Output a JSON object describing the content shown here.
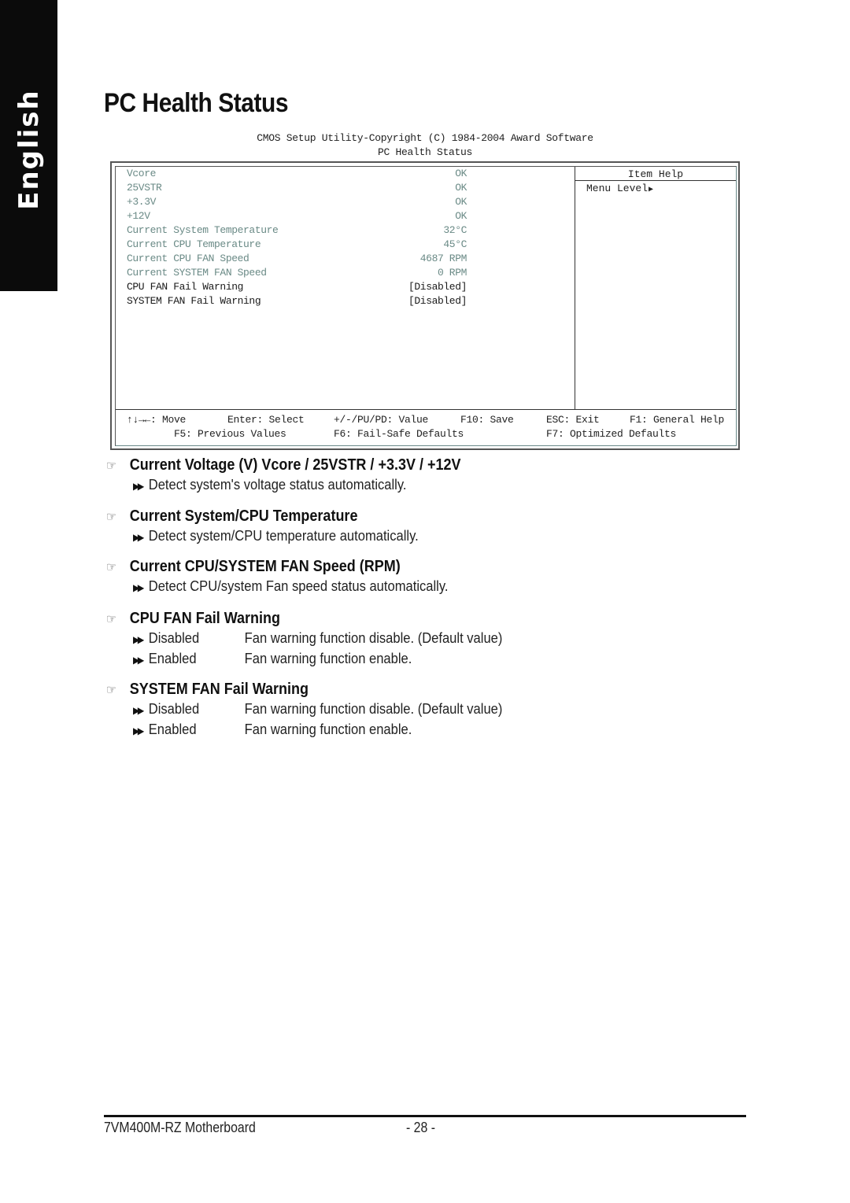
{
  "side_tab": {
    "label": "English"
  },
  "page_title": "PC Health Status",
  "bios": {
    "header_line1": "CMOS Setup Utility-Copyright (C) 1984-2004 Award Software",
    "header_line2": "PC Health Status",
    "rows": [
      {
        "label": "Vcore",
        "value": "OK",
        "editable": false
      },
      {
        "label": "25VSTR",
        "value": "OK",
        "editable": false
      },
      {
        "label": "+3.3V",
        "value": "OK",
        "editable": false
      },
      {
        "label": "+12V",
        "value": "OK",
        "editable": false
      },
      {
        "label": "Current System Temperature",
        "value": "32°C",
        "editable": false
      },
      {
        "label": "Current CPU Temperature",
        "value": "45°C",
        "editable": false
      },
      {
        "label": "Current CPU FAN Speed",
        "value": "4687 RPM",
        "editable": false
      },
      {
        "label": "Current SYSTEM FAN Speed",
        "value": "0 RPM",
        "editable": false
      },
      {
        "label": "CPU FAN Fail Warning",
        "value": "[Disabled]",
        "editable": true
      },
      {
        "label": "SYSTEM FAN Fail Warning",
        "value": "[Disabled]",
        "editable": true
      }
    ],
    "help": {
      "title": "Item Help",
      "menu_level": "Menu Level",
      "menu_level_icon": "triangle-right-icon"
    },
    "footer": {
      "move": "↑↓→←: Move",
      "enter": "Enter: Select",
      "value": "+/-/PU/PD: Value",
      "save": "F10: Save",
      "exit": "ESC: Exit",
      "help": "F1: General Help",
      "prev": "F5: Previous Values",
      "failsafe": "F6: Fail-Safe Defaults",
      "optimized": "F7: Optimized Defaults"
    },
    "colors": {
      "readonly_text": "#6a8a86",
      "editable_text": "#1a1a1a"
    }
  },
  "sections": [
    {
      "heading": "Current Voltage (V) Vcore / 25VSTR / +3.3V / +12V",
      "lines": [
        {
          "option": "",
          "text": "Detect system's voltage status automatically."
        }
      ]
    },
    {
      "heading": "Current System/CPU Temperature",
      "lines": [
        {
          "option": "",
          "text": "Detect system/CPU temperature automatically."
        }
      ]
    },
    {
      "heading": "Current CPU/SYSTEM FAN Speed (RPM)",
      "lines": [
        {
          "option": "",
          "text": "Detect CPU/system Fan speed status automatically."
        }
      ]
    },
    {
      "heading": "CPU FAN Fail Warning",
      "lines": [
        {
          "option": "Disabled",
          "text": "Fan warning function disable. (Default value)"
        },
        {
          "option": "Enabled",
          "text": "Fan warning function enable."
        }
      ]
    },
    {
      "heading": "SYSTEM FAN Fail Warning",
      "lines": [
        {
          "option": "Disabled",
          "text": "Fan warning function disable. (Default value)"
        },
        {
          "option": "Enabled",
          "text": "Fan warning function enable."
        }
      ]
    }
  ],
  "footer": {
    "product": "7VM400M-RZ Motherboard",
    "page": "- 28 -"
  }
}
